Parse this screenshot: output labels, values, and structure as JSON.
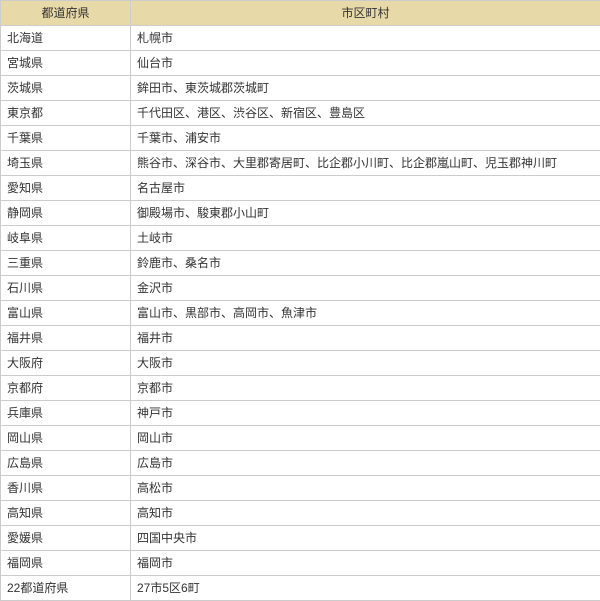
{
  "headers": {
    "pref": "都道府県",
    "city": "市区町村"
  },
  "rows": [
    {
      "pref": "北海道",
      "city": "札幌市"
    },
    {
      "pref": "宮城県",
      "city": "仙台市"
    },
    {
      "pref": "茨城県",
      "city": "鉾田市、東茨城郡茨城町"
    },
    {
      "pref": "東京都",
      "city": "千代田区、港区、渋谷区、新宿区、豊島区"
    },
    {
      "pref": "千葉県",
      "city": "千葉市、浦安市"
    },
    {
      "pref": "埼玉県",
      "city": "熊谷市、深谷市、大里郡寄居町、比企郡小川町、比企郡嵐山町、児玉郡神川町"
    },
    {
      "pref": "愛知県",
      "city": "名古屋市"
    },
    {
      "pref": "静岡県",
      "city": "御殿場市、駿東郡小山町"
    },
    {
      "pref": "岐阜県",
      "city": "土岐市"
    },
    {
      "pref": "三重県",
      "city": "鈴鹿市、桑名市"
    },
    {
      "pref": "石川県",
      "city": "金沢市"
    },
    {
      "pref": "富山県",
      "city": "富山市、黒部市、高岡市、魚津市"
    },
    {
      "pref": "福井県",
      "city": "福井市"
    },
    {
      "pref": "大阪府",
      "city": "大阪市"
    },
    {
      "pref": "京都府",
      "city": "京都市"
    },
    {
      "pref": "兵庫県",
      "city": "神戸市"
    },
    {
      "pref": "岡山県",
      "city": "岡山市"
    },
    {
      "pref": "広島県",
      "city": "広島市"
    },
    {
      "pref": "香川県",
      "city": "高松市"
    },
    {
      "pref": "高知県",
      "city": "高知市"
    },
    {
      "pref": "愛媛県",
      "city": "四国中央市"
    },
    {
      "pref": "福岡県",
      "city": "福岡市"
    },
    {
      "pref": "22都道府県",
      "city": "27市5区6町"
    }
  ]
}
